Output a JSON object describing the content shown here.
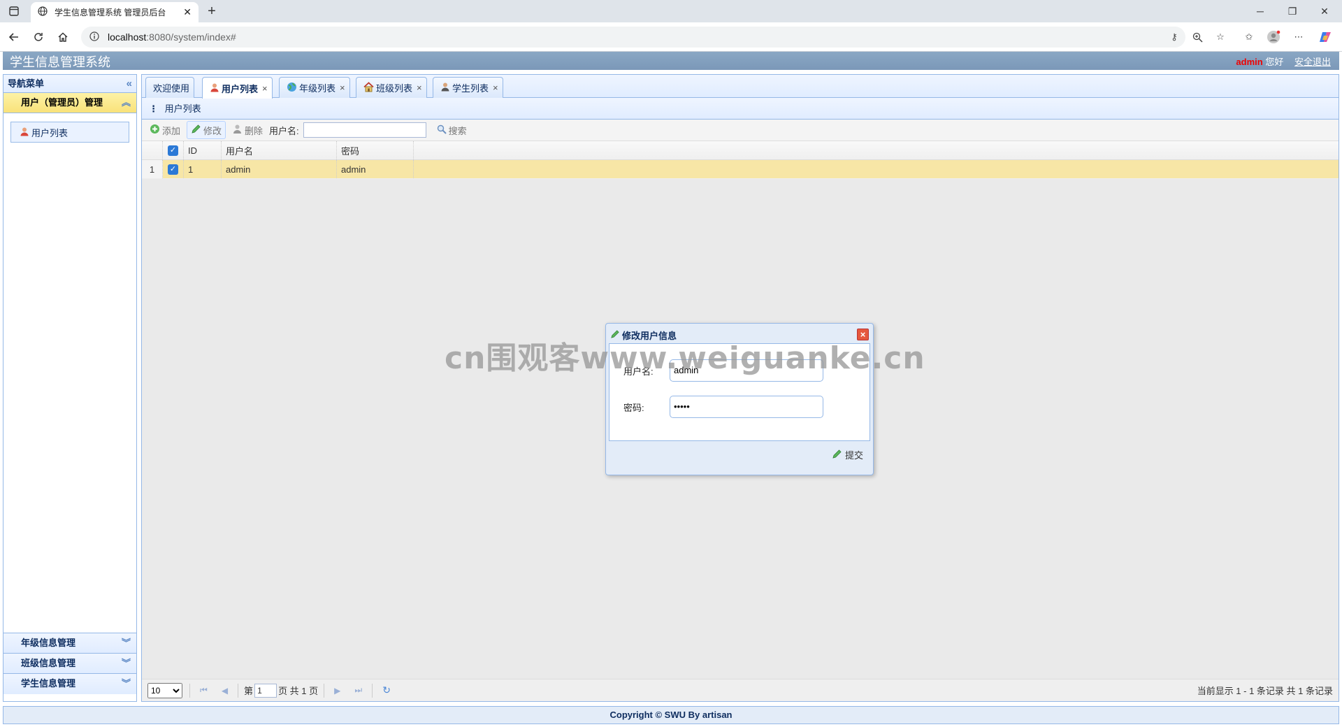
{
  "browser": {
    "tab_title": "学生信息管理系统 管理员后台",
    "url_host": "localhost",
    "url_rest": ":8080/system/index#"
  },
  "header": {
    "title": "学生信息管理系统",
    "user": "admin",
    "greeting": "您好",
    "logout": "安全退出"
  },
  "nav": {
    "title": "导航菜单",
    "sections": [
      {
        "label": "用户（管理员）管理",
        "items": [
          "用户列表"
        ]
      },
      {
        "label": "年级信息管理"
      },
      {
        "label": "班级信息管理"
      },
      {
        "label": "学生信息管理"
      }
    ]
  },
  "tabs": [
    {
      "label": "欢迎使用"
    },
    {
      "label": "用户列表"
    },
    {
      "label": "年级列表"
    },
    {
      "label": "班级列表"
    },
    {
      "label": "学生列表"
    }
  ],
  "panel": {
    "title": "用户列表",
    "toolbar": {
      "add": "添加",
      "edit": "修改",
      "delete": "删除",
      "username_label": "用户名:",
      "search": "搜索"
    },
    "columns": [
      "ID",
      "用户名",
      "密码"
    ],
    "rows": [
      {
        "num": "1",
        "id": "1",
        "username": "admin",
        "password": "admin"
      }
    ]
  },
  "pager": {
    "page_size": "10",
    "page_prefix": "第",
    "current_page": "1",
    "page_suffix": "页 共 1 页",
    "info": "当前显示 1 - 1 条记录 共 1 条记录"
  },
  "dialog": {
    "title": "修改用户信息",
    "username_label": "用户名:",
    "username_value": "admin",
    "password_label": "密码:",
    "password_value": "•••••",
    "submit": "提交"
  },
  "footer": "Copyright © SWU By artisan",
  "watermark": "cn围观客www.weiguanke.cn"
}
